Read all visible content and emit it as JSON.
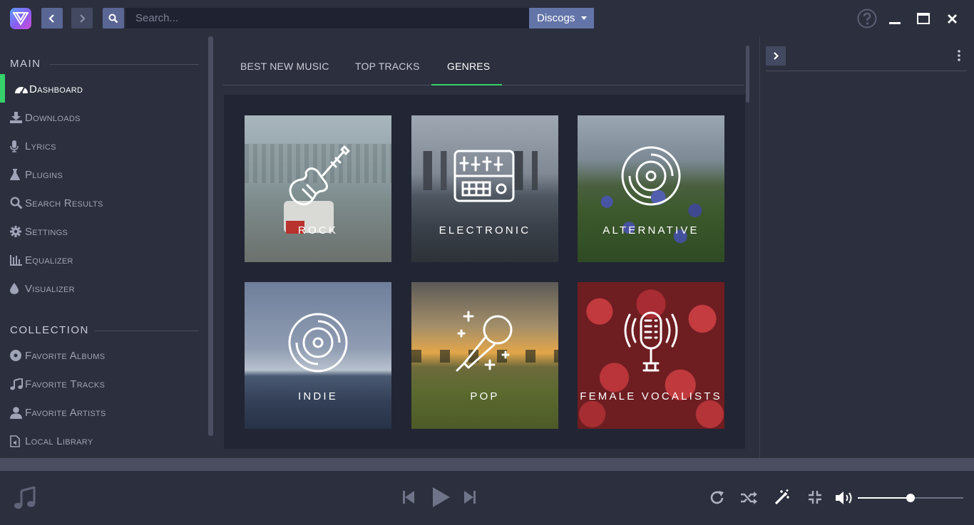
{
  "topbar": {
    "search_placeholder": "Search...",
    "source": "Discogs",
    "icons": [
      "app-logo",
      "back-arrow-icon",
      "forward-arrow-icon",
      "search-icon",
      "help-icon",
      "minimize-icon",
      "maximize-icon",
      "close-icon"
    ]
  },
  "sidebar": {
    "main_heading": "MAIN",
    "main_items": [
      {
        "label": "Dashboard",
        "icon": "dashboard-icon",
        "active": true
      },
      {
        "label": "Downloads",
        "icon": "download-icon"
      },
      {
        "label": "Lyrics",
        "icon": "microphone-icon"
      },
      {
        "label": "Plugins",
        "icon": "flask-icon"
      },
      {
        "label": "Search Results",
        "icon": "search-icon"
      },
      {
        "label": "Settings",
        "icon": "gear-icon"
      },
      {
        "label": "Equalizer",
        "icon": "equalizer-icon"
      },
      {
        "label": "Visualizer",
        "icon": "drop-icon"
      }
    ],
    "collection_heading": "COLLECTION",
    "collection_items": [
      {
        "label": "Favorite Albums",
        "icon": "disc-icon"
      },
      {
        "label": "Favorite Tracks",
        "icon": "music-note-icon"
      },
      {
        "label": "Favorite Artists",
        "icon": "user-icon"
      },
      {
        "label": "Local Library",
        "icon": "file-audio-icon"
      }
    ]
  },
  "tabs": [
    {
      "label": "BEST NEW MUSIC"
    },
    {
      "label": "TOP TRACKS"
    },
    {
      "label": "GENRES",
      "active": true
    }
  ],
  "genres": [
    {
      "label": "ROCK",
      "icon": "guitar-icon"
    },
    {
      "label": "ELECTRONIC",
      "icon": "mixer-icon"
    },
    {
      "label": "ALTERNATIVE",
      "icon": "vinyl-icon"
    },
    {
      "label": "INDIE",
      "icon": "vinyl-icon"
    },
    {
      "label": "POP",
      "icon": "microphone-icon"
    },
    {
      "label": "FEMALE VOCALISTS",
      "icon": "studio-microphone-icon"
    }
  ],
  "player": {
    "icons": [
      "music-note-icon",
      "previous-icon",
      "play-icon",
      "next-icon",
      "repeat-icon",
      "shuffle-icon",
      "magic-wand-icon",
      "compress-icon",
      "volume-icon"
    ],
    "volume": 0.5
  },
  "colors": {
    "accent": "#36d26a",
    "button": "#5a6795",
    "background": "#2c2f3d"
  }
}
